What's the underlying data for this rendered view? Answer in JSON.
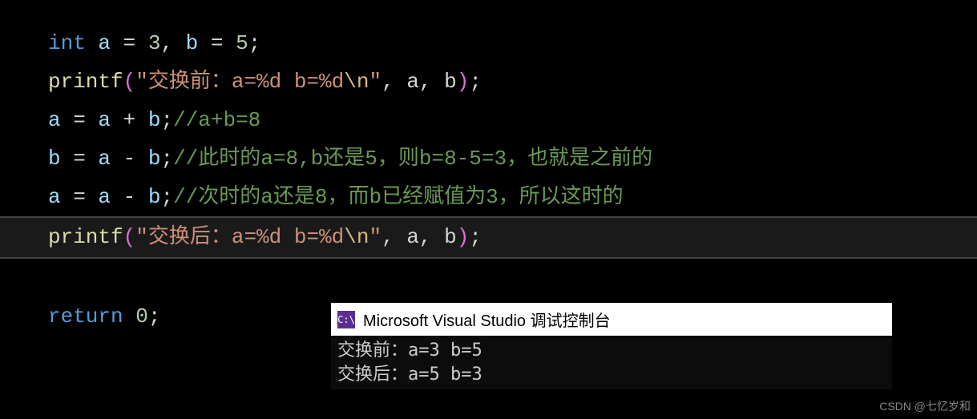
{
  "code": {
    "line1": {
      "keyword": "int",
      "var_a": "a",
      "eq1": " = ",
      "val_a": "3",
      "comma": ", ",
      "var_b": "b",
      "eq2": " = ",
      "val_b": "5",
      "semi": ";"
    },
    "line2": {
      "func": "printf",
      "lparen": "(",
      "str_open": "\"",
      "str_text": "交换前：a=%d b=%d",
      "escape": "\\n",
      "str_close": "\"",
      "args": ", a, b",
      "rparen": ")",
      "semi": ";"
    },
    "line3": {
      "var_a": "a",
      "eq": " = ",
      "expr_a": "a",
      "op": " + ",
      "expr_b": "b",
      "semi": ";",
      "comment": "//a+b=8"
    },
    "line4": {
      "var_b": "b",
      "eq": " = ",
      "expr_a": "a",
      "op": " - ",
      "expr_b": "b",
      "semi": ";",
      "comment": "//此时的a=8,b还是5，则b=8-5=3，也就是之前的"
    },
    "line5": {
      "var_a": "a",
      "eq": " = ",
      "expr_a": "a",
      "op": " - ",
      "expr_b": "b",
      "semi": ";",
      "comment": "//次时的a还是8，而b已经赋值为3，所以这时的"
    },
    "line6": {
      "func": "printf",
      "lparen": "(",
      "str_open": "\"",
      "str_text": "交换后：a=%d b=%d",
      "escape": "\\n",
      "str_close": "\"",
      "args": ", a, b",
      "rparen": ")",
      "semi": ";"
    },
    "line7": {
      "keyword": "return",
      "space": " ",
      "val": "0",
      "semi": ";"
    }
  },
  "console": {
    "icon_text": "C:\\",
    "title": "Microsoft Visual Studio 调试控制台",
    "output_line1": "交换前：a=3 b=5",
    "output_line2": "交换后：a=5 b=3"
  },
  "watermark": "CSDN @七忆岁和"
}
